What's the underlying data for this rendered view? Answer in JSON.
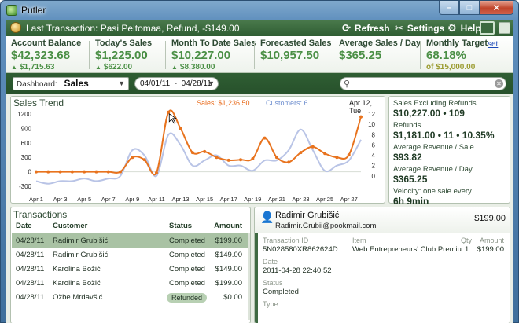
{
  "window": {
    "title": "Putler",
    "min": "–",
    "max": "□",
    "close": "✕"
  },
  "topbar": {
    "last_transaction": "Last Transaction: Pasi Peltomaa, Refund, -$149.00",
    "refresh": "Refresh",
    "settings": "Settings",
    "help": "Help"
  },
  "stats": [
    {
      "label": "Account Balance",
      "value": "$42,323.68",
      "sub": "$1,715.63"
    },
    {
      "label": "Today's Sales",
      "value": "$1,225.00",
      "sub": "$622.00"
    },
    {
      "label": "Month To Date Sales",
      "value": "$10,227.00",
      "sub": "$8,380.00"
    },
    {
      "label": "Forecasted Sales",
      "value": "$10,957.50"
    },
    {
      "label": "Average Sales / Day",
      "value": "$365.25"
    },
    {
      "label": "Monthly Target",
      "value": "68.18%",
      "sub": "of $15,000.00",
      "link": "set"
    }
  ],
  "filters": {
    "dashboard_label": "Dashboard:",
    "dashboard_value": "Sales",
    "date_range": "04/01/11  -  04/28/11",
    "search_placeholder": ""
  },
  "chart": {
    "title": "Sales Trend",
    "legend_sales": "Sales: $1,236.50",
    "legend_customers": "Customers: 6",
    "date": "Apr 12, Tue"
  },
  "chart_data": {
    "type": "line",
    "x": [
      "Apr 1",
      "Apr 2",
      "Apr 3",
      "Apr 4",
      "Apr 5",
      "Apr 6",
      "Apr 7",
      "Apr 8",
      "Apr 9",
      "Apr 10",
      "Apr 11",
      "Apr 12",
      "Apr 13",
      "Apr 14",
      "Apr 15",
      "Apr 16",
      "Apr 17",
      "Apr 18",
      "Apr 19",
      "Apr 20",
      "Apr 21",
      "Apr 22",
      "Apr 23",
      "Apr 24",
      "Apr 25",
      "Apr 26",
      "Apr 27",
      "Apr 28"
    ],
    "x_tick_labels": [
      "Apr 1",
      "Apr 3",
      "Apr 5",
      "Apr 7",
      "Apr 9",
      "Apr 11",
      "Apr 13",
      "Apr 15",
      "Apr 17",
      "Apr 19",
      "Apr 21",
      "Apr 23",
      "Apr 25",
      "Apr 27"
    ],
    "y_left_ticks": [
      "1200",
      "900",
      "600",
      "300",
      "0",
      "-300"
    ],
    "y_right_ticks": [
      "12",
      "10",
      "8",
      "6",
      "4",
      "2",
      "0"
    ],
    "y_left_range": [
      -300,
      1200
    ],
    "y_right_range": [
      -2,
      12
    ],
    "series": [
      {
        "name": "Sales",
        "axis": "left",
        "color": "#e8731e",
        "values": [
          0,
          0,
          0,
          0,
          0,
          0,
          0,
          0,
          300,
          250,
          -20,
          1236.5,
          900,
          400,
          420,
          300,
          240,
          250,
          270,
          700,
          300,
          200,
          400,
          520,
          380,
          300,
          350,
          1140
        ]
      },
      {
        "name": "Customers",
        "axis": "right",
        "color": "#b9c4e6",
        "values": [
          -1,
          -1.5,
          -1,
          -1,
          -0.5,
          -1,
          -0.5,
          0,
          5,
          4,
          0,
          8,
          6,
          2,
          3,
          4,
          2,
          2,
          1,
          3,
          3,
          5,
          9,
          5,
          1,
          2,
          3,
          7
        ]
      }
    ]
  },
  "side_stats": [
    {
      "label": "Sales Excluding Refunds",
      "value": "$10,227.00 • 109"
    },
    {
      "label": "Refunds",
      "value": "$1,181.00 • 11 • 10.35%"
    },
    {
      "label": "Average Revenue / Sale",
      "value": "$93.82"
    },
    {
      "label": "Average Revenue / Day",
      "value": "$365.25"
    },
    {
      "label": "Velocity: one sale every",
      "value": "6h 9min"
    }
  ],
  "transactions": {
    "title": "Transactions",
    "columns": {
      "date": "Date",
      "customer": "Customer",
      "status": "Status",
      "amount": "Amount"
    },
    "rows": [
      {
        "date": "04/28/11",
        "customer": "Radimir Grubišić",
        "status": "Completed",
        "amount": "$199.00"
      },
      {
        "date": "04/28/11",
        "customer": "Radimir Grubišić",
        "status": "Completed",
        "amount": "$149.00"
      },
      {
        "date": "04/28/11",
        "customer": "Karolina Božić",
        "status": "Completed",
        "amount": "$149.00"
      },
      {
        "date": "04/28/11",
        "customer": "Karolina Božić",
        "status": "Completed",
        "amount": "$199.00"
      },
      {
        "date": "04/28/11",
        "customer": "Ožbe Mrdavšić",
        "status": "Refunded",
        "amount": "$0.00"
      }
    ]
  },
  "detail": {
    "name": "Radimir Grubišić",
    "email": "Radimir.Grubii@pookmail.com",
    "amount": "$199.00",
    "transaction_id_label": "Transaction ID",
    "transaction_id": "5N028580XR862624D",
    "item_label": "Item",
    "item": "Web Entrepreneurs' Club Premiu...",
    "qty_label": "Qty",
    "qty": "1",
    "amount_label": "Amount",
    "item_amount": "$199.00",
    "date_label": "Date",
    "date": "2011-04-28 22:40:52",
    "status_label": "Status",
    "status": "Completed",
    "type_label": "Type"
  }
}
